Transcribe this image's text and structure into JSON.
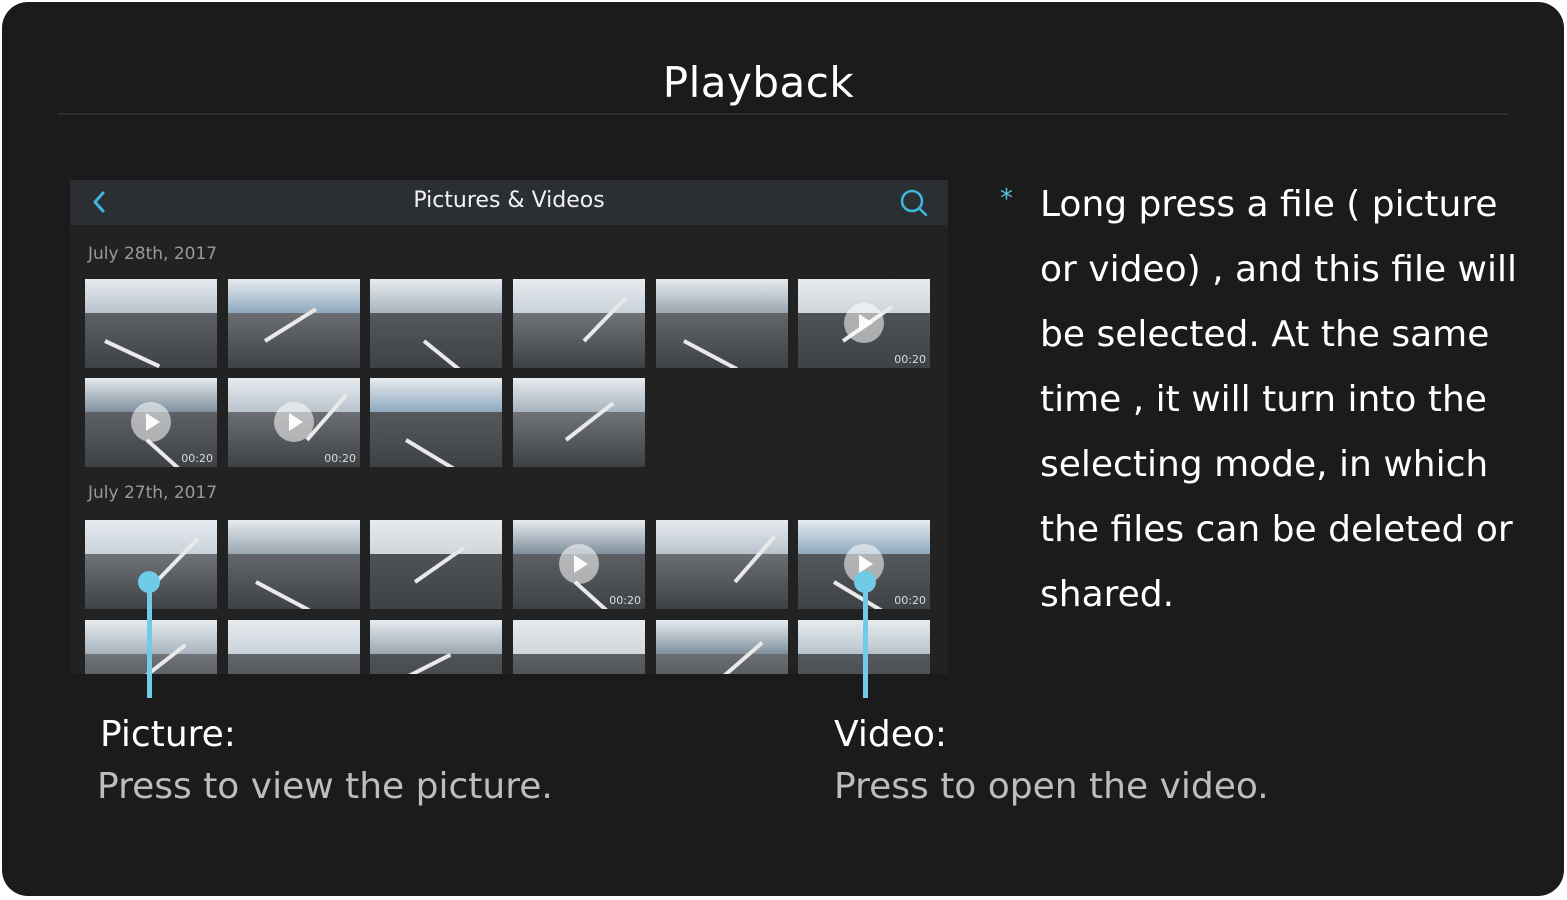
{
  "screen": {
    "title": "Playback"
  },
  "phone": {
    "topbar": {
      "title": "Pictures & Videos",
      "back_icon": "chevron-left-icon",
      "search_icon": "search-icon",
      "accent": "#3fb6dc"
    },
    "groups": [
      {
        "date": "July 28th, 2017",
        "thumbs": [
          {
            "type": "picture",
            "duration": ""
          },
          {
            "type": "picture",
            "duration": ""
          },
          {
            "type": "picture",
            "duration": ""
          },
          {
            "type": "picture",
            "duration": ""
          },
          {
            "type": "picture",
            "duration": ""
          },
          {
            "type": "video",
            "duration": "00:20"
          },
          {
            "type": "video",
            "duration": "00:20"
          },
          {
            "type": "video",
            "duration": "00:20"
          },
          {
            "type": "picture",
            "duration": ""
          },
          {
            "type": "picture",
            "duration": ""
          }
        ]
      },
      {
        "date": "July 27th, 2017",
        "thumbs": [
          {
            "type": "picture",
            "duration": ""
          },
          {
            "type": "picture",
            "duration": ""
          },
          {
            "type": "picture",
            "duration": ""
          },
          {
            "type": "video",
            "duration": "00:20"
          },
          {
            "type": "picture",
            "duration": ""
          },
          {
            "type": "video",
            "duration": "00:20"
          },
          {
            "type": "picture",
            "duration": ""
          },
          {
            "type": "picture",
            "duration": ""
          },
          {
            "type": "picture",
            "duration": ""
          },
          {
            "type": "picture",
            "duration": ""
          },
          {
            "type": "picture",
            "duration": ""
          },
          {
            "type": "picture",
            "duration": ""
          }
        ]
      }
    ]
  },
  "callouts": {
    "picture": {
      "head": "Picture:",
      "desc": "Press to view the picture."
    },
    "video": {
      "head": "Video:",
      "desc": "Press to open the video."
    },
    "pointer_color": "#6fcbe6"
  },
  "instructions": {
    "bullet": "*",
    "lines": [
      "Long press a file ( picture",
      "or video) , and this file will",
      "be selected.  At the same",
      "time ,   it will turn into the",
      "selecting mode, in which",
      "the files can be deleted or",
      "shared."
    ]
  }
}
